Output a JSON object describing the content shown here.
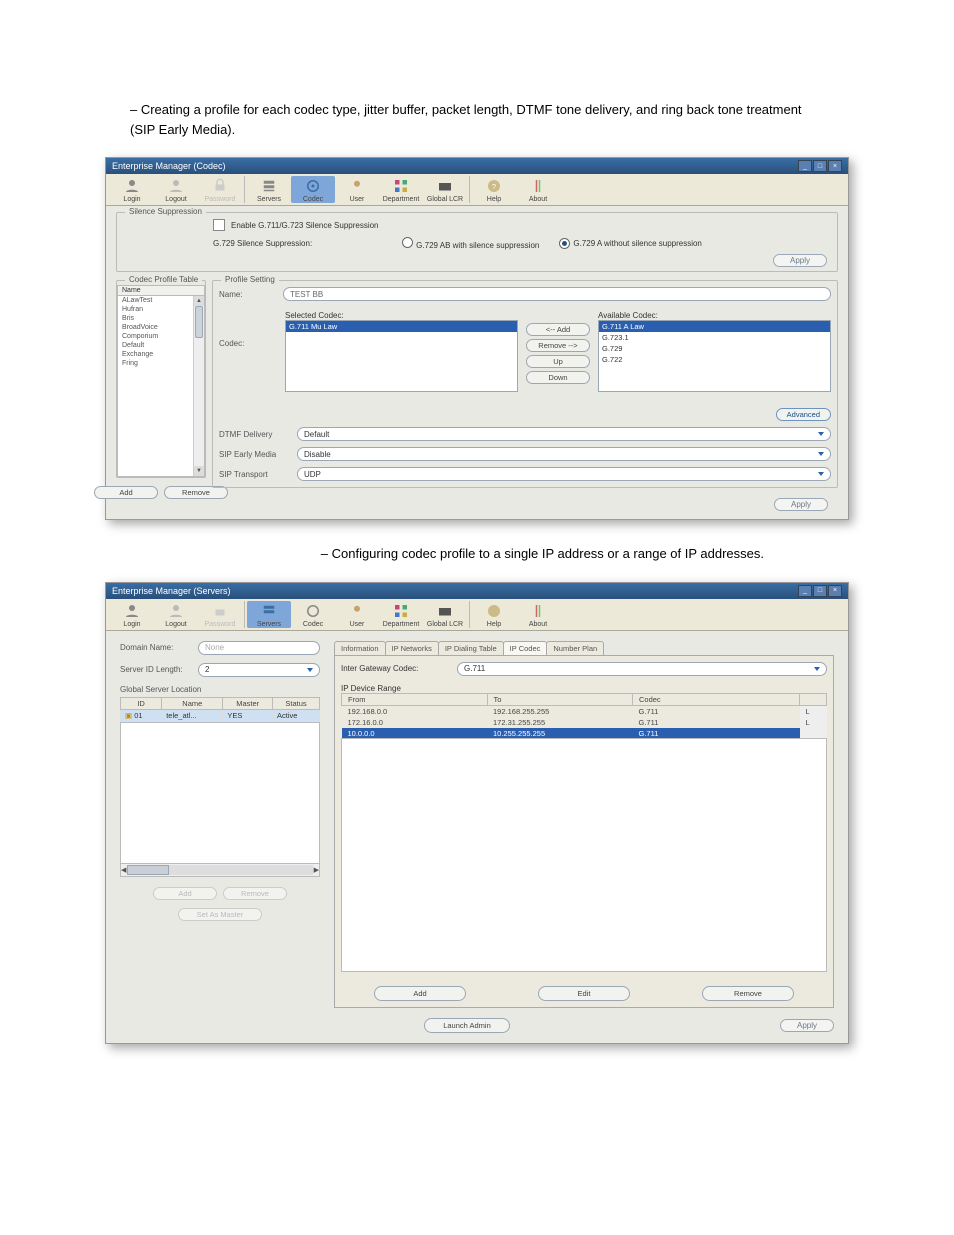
{
  "caption1": "– Creating a profile for each codec type, jitter buffer, packet length, DTMF tone delivery, and ring back tone treatment (SIP Early Media).",
  "caption2": "– Configuring codec profile to a single IP address or a range of IP addresses.",
  "shot1": {
    "title": "Enterprise Manager (Codec)",
    "toolbar": [
      "Login",
      "Logout",
      "Password",
      "Servers",
      "Codec",
      "User",
      "Department",
      "Global LCR",
      "Help",
      "About"
    ],
    "silence": {
      "legend": "Silence Suppression",
      "enable": "Enable G.711/G.723 Silence Suppression",
      "g729label": "G.729 Silence Suppression:",
      "opt1": "G.729 AB with silence suppression",
      "opt2": "G.729 A without silence suppression",
      "apply": "Apply"
    },
    "profile": {
      "table_legend": "Codec Profile Table",
      "col": "Name",
      "items": [
        "ALawTest",
        "Hufran",
        "Bris",
        "BroadVoice",
        "Comporium",
        "Default",
        "Exchange",
        "Fring"
      ],
      "add": "Add",
      "remove": "Remove",
      "setting_legend": "Profile Setting",
      "name_lbl": "Name:",
      "name_val": "TEST BB",
      "codec_lbl": "Codec:",
      "sel_lbl": "Selected Codec:",
      "sel_item": "G.711 Mu Law",
      "avail_lbl": "Available Codec:",
      "avail": [
        "G.711 A Law",
        "G.723.1",
        "G.729",
        "G.722"
      ],
      "add_btn": "<-- Add",
      "rem_btn": "Remove -->",
      "up": "Up",
      "down": "Down",
      "advanced": "Advanced",
      "dtmf_lbl": "DTMF Delivery",
      "dtmf_val": "Default",
      "sem_lbl": "SIP Early Media",
      "sem_val": "Disable",
      "trans_lbl": "SIP Transport",
      "trans_val": "UDP",
      "apply": "Apply"
    }
  },
  "shot2": {
    "title": "Enterprise Manager (Servers)",
    "toolbar": [
      "Login",
      "Logout",
      "Password",
      "Servers",
      "Codec",
      "User",
      "Department",
      "Global LCR",
      "Help",
      "About"
    ],
    "domain_lbl": "Domain Name:",
    "domain_val": "None",
    "sid_lbl": "Server ID Length:",
    "sid_val": "2",
    "gsl": "Global Server Location",
    "cols": [
      "ID",
      "Name",
      "Master",
      "Status"
    ],
    "row": {
      "id": "01",
      "name": "tele_atl...",
      "master": "YES",
      "status": "Active"
    },
    "left_add": "Add",
    "left_remove": "Remove",
    "left_edit": "Set As Master",
    "tabs": [
      "Information",
      "IP Networks",
      "IP Dialing Table",
      "IP Codec",
      "Number Plan"
    ],
    "active_tab": 3,
    "igc_lbl": "Inter Gateway Codec:",
    "igc_val": "G.711",
    "range_lbl": "IP Device Range",
    "rcols": [
      "From",
      "To",
      "Codec"
    ],
    "rows": [
      {
        "from": "192.168.0.0",
        "to": "192.168.255.255",
        "codec": "G.711"
      },
      {
        "from": "172.16.0.0",
        "to": "172.31.255.255",
        "codec": "G.711"
      },
      {
        "from": "10.0.0.0",
        "to": "10.255.255.255",
        "codec": "G.711"
      }
    ],
    "btn_add": "Add",
    "btn_edit": "Edit",
    "btn_remove": "Remove",
    "btn_launch": "Launch Admin",
    "btn_apply": "Apply"
  }
}
